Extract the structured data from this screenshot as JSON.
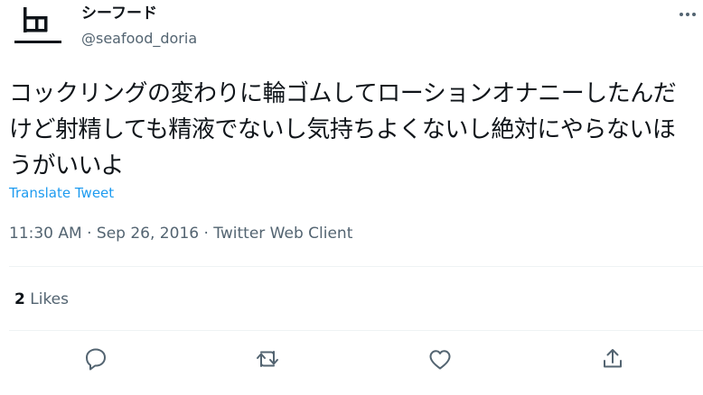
{
  "author": {
    "name": "シーフード",
    "handle": "@seafood_doria"
  },
  "tweet": {
    "text": "コックリングの変わりに輪ゴムしてローションオナニーしたんだけど射精しても精液でないし気持ちよくないし絶対にやらないほうがいいよ",
    "translate_label": "Translate Tweet"
  },
  "meta": {
    "time": "11:30 AM",
    "separator1": " · ",
    "date": "Sep 26, 2016",
    "separator2": " · ",
    "client": "Twitter Web Client"
  },
  "stats": {
    "likes_count": "2",
    "likes_label": "Likes"
  },
  "icons": {
    "more": "more-icon",
    "reply": "reply-icon",
    "retweet": "retweet-icon",
    "like": "like-icon",
    "share": "share-icon"
  },
  "colors": {
    "text": "#0f1419",
    "secondary": "#536471",
    "link": "#1d9bf0",
    "divider": "#eff3f4"
  }
}
